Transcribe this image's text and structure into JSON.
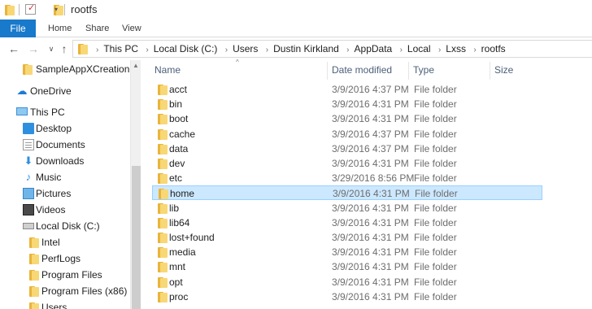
{
  "window": {
    "title": "rootfs",
    "quick_access_toolbar": [
      "folder-icon",
      "properties-checkbox-icon",
      "new-folder-icon",
      "customize-dropdown-icon"
    ]
  },
  "ribbon": {
    "tabs": [
      {
        "label": "File",
        "active": true
      },
      {
        "label": "Home"
      },
      {
        "label": "Share"
      },
      {
        "label": "View"
      }
    ],
    "accent_color": "#1979ca"
  },
  "navigation": {
    "back_icon": "arrow-left-icon",
    "forward_icon": "arrow-right-icon",
    "recent_icon": "chevron-down-icon",
    "up_icon": "arrow-up-icon"
  },
  "address": {
    "crumbs": [
      "This PC",
      "Local Disk (C:)",
      "Users",
      "Dustin Kirkland",
      "AppData",
      "Local",
      "Lxss",
      "rootfs"
    ]
  },
  "nav_pane": {
    "items": [
      {
        "label": "SampleAppXCreation",
        "icon": "folder-icon"
      },
      {
        "label": "OneDrive",
        "icon": "cloud-icon"
      },
      {
        "label": "This PC",
        "icon": "computer-icon"
      },
      {
        "label": "Desktop",
        "icon": "desktop-icon"
      },
      {
        "label": "Documents",
        "icon": "documents-icon"
      },
      {
        "label": "Downloads",
        "icon": "downloads-icon"
      },
      {
        "label": "Music",
        "icon": "music-icon"
      },
      {
        "label": "Pictures",
        "icon": "pictures-icon"
      },
      {
        "label": "Videos",
        "icon": "videos-icon"
      },
      {
        "label": "Local Disk (C:)",
        "icon": "disk-icon"
      },
      {
        "label": "Intel",
        "icon": "folder-icon"
      },
      {
        "label": "PerfLogs",
        "icon": "folder-icon"
      },
      {
        "label": "Program Files",
        "icon": "folder-icon"
      },
      {
        "label": "Program Files (x86)",
        "icon": "folder-icon"
      },
      {
        "label": "Users",
        "icon": "folder-icon"
      }
    ]
  },
  "file_list": {
    "columns": [
      "Name",
      "Date modified",
      "Type",
      "Size"
    ],
    "selected_color": "#cce8ff",
    "rows": [
      {
        "name": "acct",
        "date": "3/9/2016 4:37 PM",
        "type": "File folder"
      },
      {
        "name": "bin",
        "date": "3/9/2016 4:31 PM",
        "type": "File folder"
      },
      {
        "name": "boot",
        "date": "3/9/2016 4:31 PM",
        "type": "File folder"
      },
      {
        "name": "cache",
        "date": "3/9/2016 4:37 PM",
        "type": "File folder"
      },
      {
        "name": "data",
        "date": "3/9/2016 4:37 PM",
        "type": "File folder"
      },
      {
        "name": "dev",
        "date": "3/9/2016 4:31 PM",
        "type": "File folder"
      },
      {
        "name": "etc",
        "date": "3/29/2016 8:56 PM",
        "type": "File folder"
      },
      {
        "name": "home",
        "date": "3/9/2016 4:31 PM",
        "type": "File folder",
        "selected": true
      },
      {
        "name": "lib",
        "date": "3/9/2016 4:31 PM",
        "type": "File folder"
      },
      {
        "name": "lib64",
        "date": "3/9/2016 4:31 PM",
        "type": "File folder"
      },
      {
        "name": "lost+found",
        "date": "3/9/2016 4:31 PM",
        "type": "File folder"
      },
      {
        "name": "media",
        "date": "3/9/2016 4:31 PM",
        "type": "File folder"
      },
      {
        "name": "mnt",
        "date": "3/9/2016 4:31 PM",
        "type": "File folder"
      },
      {
        "name": "opt",
        "date": "3/9/2016 4:31 PM",
        "type": "File folder"
      },
      {
        "name": "proc",
        "date": "3/9/2016 4:31 PM",
        "type": "File folder"
      }
    ]
  }
}
